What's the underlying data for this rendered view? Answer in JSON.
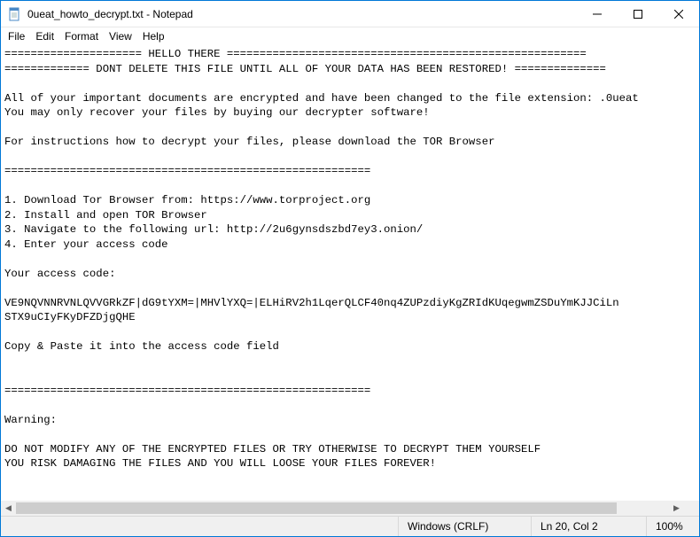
{
  "window": {
    "title": "0ueat_howto_decrypt.txt - Notepad"
  },
  "menu": {
    "file": "File",
    "edit": "Edit",
    "format": "Format",
    "view": "View",
    "help": "Help"
  },
  "body": {
    "text": "===================== HELLO THERE =======================================================\n============= DONT DELETE THIS FILE UNTIL ALL OF YOUR DATA HAS BEEN RESTORED! ==============\n\nAll of your important documents are encrypted and have been changed to the file extension: .0ueat\nYou may only recover your files by buying our decrypter software!\n\nFor instructions how to decrypt your files, please download the TOR Browser\n\n========================================================\n\n1. Download Tor Browser from: https://www.torproject.org\n2. Install and open TOR Browser\n3. Navigate to the following url: http://2u6gynsdszbd7ey3.onion/\n4. Enter your access code\n\nYour access code:\n\nVE9NQVNNRVNLQVVGRkZF|dG9tYXM=|MHVlYXQ=|ELHiRV2h1LqerQLCF40nq4ZUPzdiyKgZRIdKUqegwmZSDuYmKJJCiLn\nSTX9uCIyFKyDFZDjgQHE\n\nCopy & Paste it into the access code field\n\n\n========================================================\n\nWarning:\n\nDO NOT MODIFY ANY OF THE ENCRYPTED FILES OR TRY OTHERWISE TO DECRYPT THEM YOURSELF\nYOU RISK DAMAGING THE FILES AND YOU WILL LOOSE YOUR FILES FOREVER!"
  },
  "status": {
    "encoding": "Windows (CRLF)",
    "position": "Ln 20, Col 2",
    "zoom": "100%"
  }
}
